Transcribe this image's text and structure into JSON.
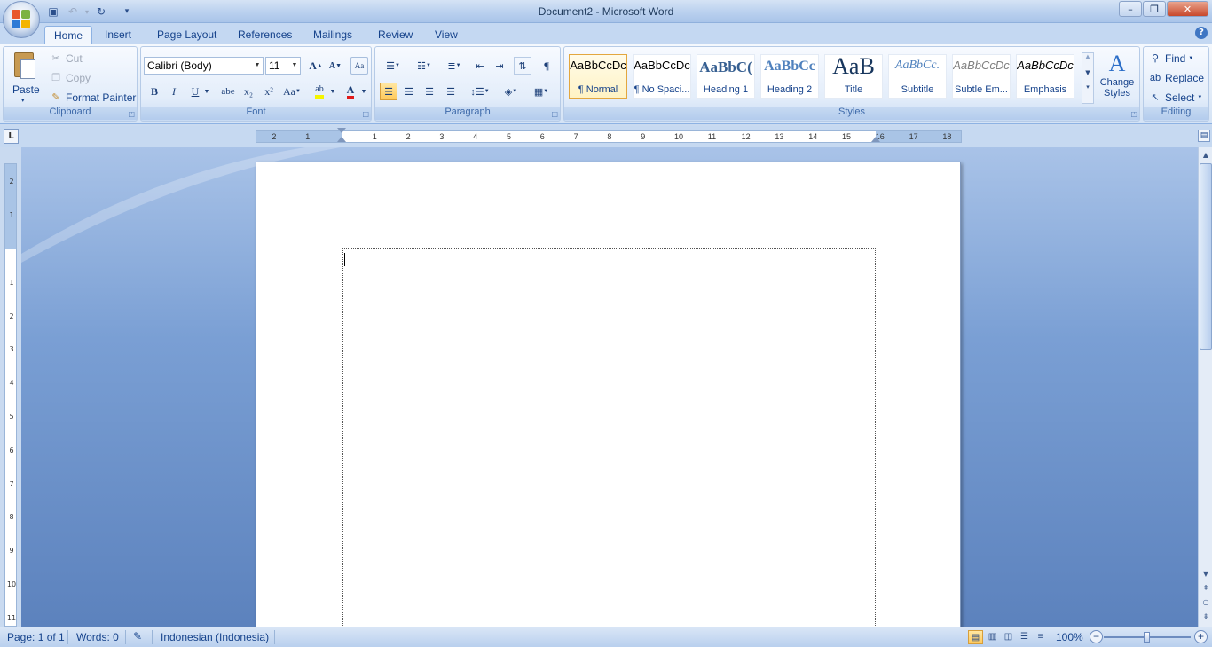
{
  "window": {
    "title": "Document2 - Microsoft Word",
    "minimize": "–",
    "restore": "❐",
    "close": "✕"
  },
  "quick_access": {
    "save_icon": "save-icon",
    "undo_icon": "undo-icon",
    "redo_icon": "redo-icon",
    "customize_icon": "dropdown-icon"
  },
  "tabs": [
    {
      "label": "Home",
      "active": true
    },
    {
      "label": "Insert"
    },
    {
      "label": "Page Layout"
    },
    {
      "label": "References"
    },
    {
      "label": "Mailings"
    },
    {
      "label": "Review"
    },
    {
      "label": "View"
    }
  ],
  "clipboard": {
    "label": "Clipboard",
    "paste": "Paste",
    "cut": "Cut",
    "copy": "Copy",
    "format_painter": "Format Painter"
  },
  "font": {
    "label": "Font",
    "family": "Calibri (Body)",
    "size": "11",
    "grow": "A",
    "shrink": "A",
    "bold": "B",
    "italic": "I",
    "underline": "U",
    "strike": "abe",
    "subscript": "x₂",
    "superscript": "x²",
    "change_case": "Aa",
    "font_color": "A"
  },
  "paragraph": {
    "label": "Paragraph",
    "show_hide": "¶"
  },
  "styles": {
    "label": "Styles",
    "items": [
      {
        "preview": "AaBbCcDc",
        "name": "¶ Normal",
        "selected": true
      },
      {
        "preview": "AaBbCcDc",
        "name": "¶ No Spaci..."
      },
      {
        "preview": "AaBbC(",
        "name": "Heading 1"
      },
      {
        "preview": "AaBbCc",
        "name": "Heading 2"
      },
      {
        "preview": "AaB",
        "name": "Title"
      },
      {
        "preview": "AaBbCc.",
        "name": "Subtitle"
      },
      {
        "preview": "AaBbCcDc",
        "name": "Subtle Em..."
      },
      {
        "preview": "AaBbCcDc",
        "name": "Emphasis"
      }
    ],
    "change_styles": "Change Styles"
  },
  "editing": {
    "label": "Editing",
    "find": "Find",
    "replace": "Replace",
    "select": "Select"
  },
  "ruler": {
    "tab_selector": "L",
    "labels_left": [
      "2",
      "1"
    ],
    "labels_right": [
      "1",
      "2",
      "3",
      "4",
      "5",
      "6",
      "7",
      "8",
      "9",
      "10",
      "11",
      "12",
      "13",
      "14",
      "15",
      "16",
      "17",
      "18"
    ],
    "vertical_labels": [
      "2",
      "1",
      "1",
      "2",
      "3",
      "4",
      "5",
      "6",
      "7",
      "8",
      "9",
      "10",
      "11"
    ]
  },
  "status": {
    "page": "Page: 1 of 1",
    "words": "Words: 0",
    "language": "Indonesian (Indonesia)",
    "zoom": "100%",
    "zoom_fraction": 0.5
  }
}
